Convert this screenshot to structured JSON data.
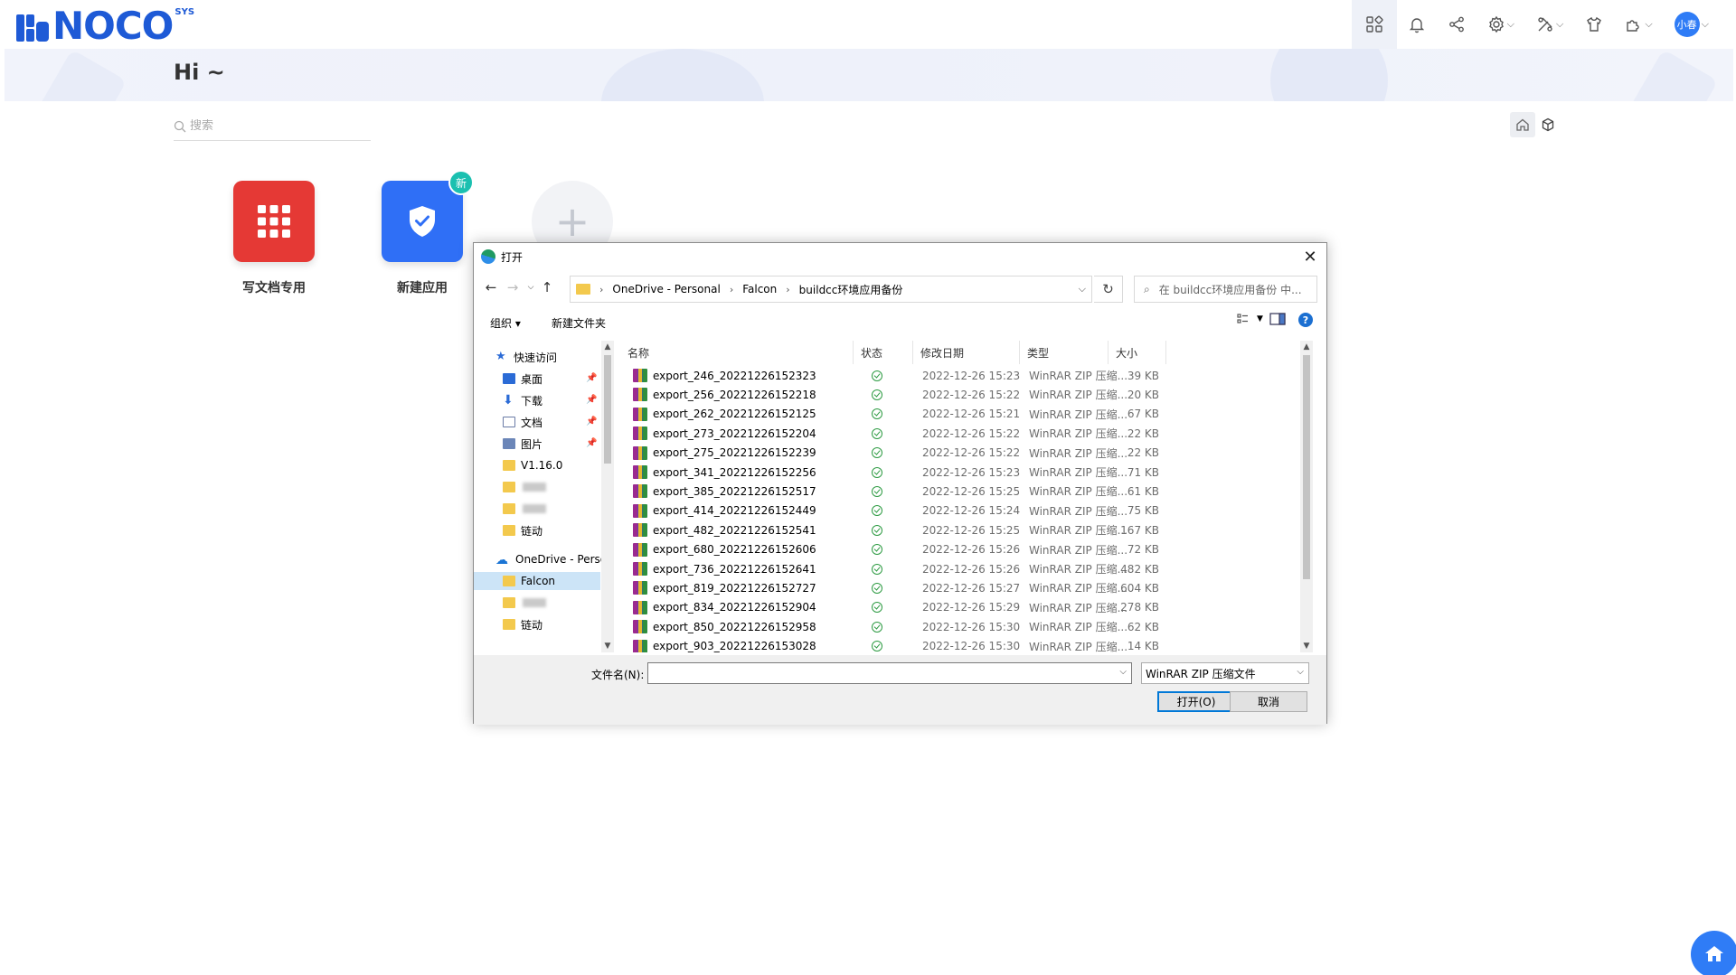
{
  "header": {
    "logo_text": "NOCO",
    "logo_sup": "SYS",
    "icons": [
      "grid-icon",
      "bell-icon",
      "share-icon",
      "gear-icon",
      "tools-icon",
      "shirt-icon",
      "puzzle-icon"
    ],
    "avatar_text": "小春"
  },
  "greeting": "Hi ~",
  "search": {
    "placeholder": "搜索"
  },
  "apps": [
    {
      "label": "写文档专用",
      "color": "#e53935"
    },
    {
      "label": "新建应用",
      "color": "#2f6ff6",
      "badge": "新"
    }
  ],
  "dialog": {
    "title": "打开",
    "breadcrumb": [
      "OneDrive - Personal",
      "Falcon",
      "buildcc环境应用备份"
    ],
    "search_placeholder": "在 buildcc环境应用备份 中...",
    "toolbar": {
      "organize": "组织 ▾",
      "new_folder": "新建文件夹"
    },
    "nav": {
      "quick_access": "快速访问",
      "items": [
        "桌面",
        "下载",
        "文档",
        "图片",
        "V1.16.0",
        "链动"
      ],
      "onedrive": "OneDrive - Perso",
      "onedrive_items": [
        "Falcon",
        "链动"
      ]
    },
    "columns": {
      "name": "名称",
      "status": "状态",
      "modified": "修改日期",
      "type": "类型",
      "size": "大小"
    },
    "files": [
      {
        "name": "export_246_20221226152323",
        "date": "2022-12-26 15:23",
        "type": "WinRAR ZIP 压缩...",
        "size": "39 KB"
      },
      {
        "name": "export_256_20221226152218",
        "date": "2022-12-26 15:22",
        "type": "WinRAR ZIP 压缩...",
        "size": "20 KB"
      },
      {
        "name": "export_262_20221226152125",
        "date": "2022-12-26 15:21",
        "type": "WinRAR ZIP 压缩...",
        "size": "67 KB"
      },
      {
        "name": "export_273_20221226152204",
        "date": "2022-12-26 15:22",
        "type": "WinRAR ZIP 压缩...",
        "size": "22 KB"
      },
      {
        "name": "export_275_20221226152239",
        "date": "2022-12-26 15:22",
        "type": "WinRAR ZIP 压缩...",
        "size": "22 KB"
      },
      {
        "name": "export_341_20221226152256",
        "date": "2022-12-26 15:23",
        "type": "WinRAR ZIP 压缩...",
        "size": "71 KB"
      },
      {
        "name": "export_385_20221226152517",
        "date": "2022-12-26 15:25",
        "type": "WinRAR ZIP 压缩...",
        "size": "61 KB"
      },
      {
        "name": "export_414_20221226152449",
        "date": "2022-12-26 15:24",
        "type": "WinRAR ZIP 压缩...",
        "size": "75 KB"
      },
      {
        "name": "export_482_20221226152541",
        "date": "2022-12-26 15:25",
        "type": "WinRAR ZIP 压缩...",
        "size": "167 KB"
      },
      {
        "name": "export_680_20221226152606",
        "date": "2022-12-26 15:26",
        "type": "WinRAR ZIP 压缩...",
        "size": "72 KB"
      },
      {
        "name": "export_736_20221226152641",
        "date": "2022-12-26 15:26",
        "type": "WinRAR ZIP 压缩...",
        "size": "482 KB"
      },
      {
        "name": "export_819_20221226152727",
        "date": "2022-12-26 15:27",
        "type": "WinRAR ZIP 压缩...",
        "size": "604 KB"
      },
      {
        "name": "export_834_20221226152904",
        "date": "2022-12-26 15:29",
        "type": "WinRAR ZIP 压缩...",
        "size": "278 KB"
      },
      {
        "name": "export_850_20221226152958",
        "date": "2022-12-26 15:30",
        "type": "WinRAR ZIP 压缩...",
        "size": "62 KB"
      },
      {
        "name": "export_903_20221226153028",
        "date": "2022-12-26 15:30",
        "type": "WinRAR ZIP 压缩...",
        "size": "14 KB"
      }
    ],
    "filename_label": "文件名(N):",
    "filename_value": "",
    "filetype": "WinRAR ZIP 压缩文件",
    "open_button": "打开(O)",
    "cancel_button": "取消"
  }
}
